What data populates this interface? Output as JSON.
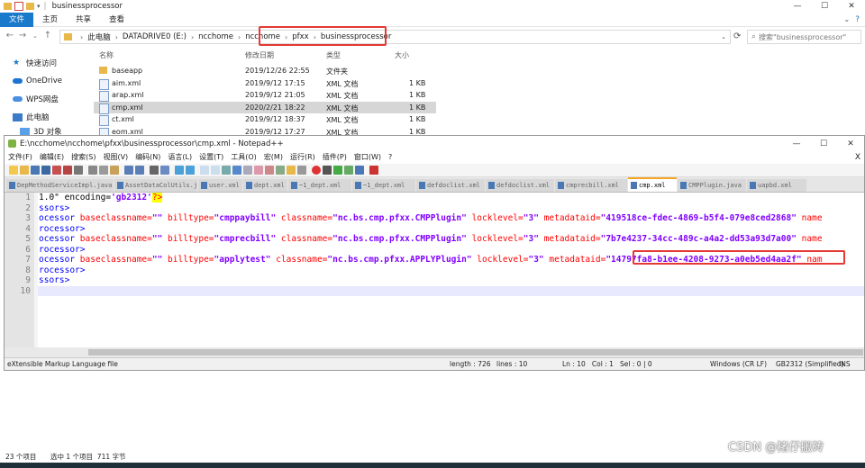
{
  "explorer": {
    "title": "businessprocessor",
    "ribbon_tabs": [
      "文件",
      "主页",
      "共享",
      "查看"
    ],
    "breadcrumb": [
      "此电脑",
      "DATADRIVE0 (E:)",
      "ncchome",
      "ncchome",
      "pfxx",
      "businessprocessor"
    ],
    "search_placeholder": "搜索\"businessprocessor\"",
    "columns": {
      "name": "名称",
      "date": "修改日期",
      "type": "类型",
      "size": "大小"
    },
    "nav_items": [
      "快速访问",
      "OneDrive",
      "WPS网盘",
      "此电脑",
      "3D 对象"
    ],
    "files": [
      {
        "name": "baseapp",
        "date": "2019/12/26 22:55",
        "type": "文件夹",
        "size": "",
        "kind": "folder"
      },
      {
        "name": "aim.xml",
        "date": "2019/9/12 17:15",
        "type": "XML 文档",
        "size": "1 KB",
        "kind": "xml"
      },
      {
        "name": "arap.xml",
        "date": "2019/9/12 21:05",
        "type": "XML 文档",
        "size": "1 KB",
        "kind": "xml"
      },
      {
        "name": "cmp.xml",
        "date": "2020/2/21 18:22",
        "type": "XML 文档",
        "size": "1 KB",
        "kind": "xml",
        "selected": true
      },
      {
        "name": "ct.xml",
        "date": "2019/9/12 18:37",
        "type": "XML 文档",
        "size": "1 KB",
        "kind": "xml"
      },
      {
        "name": "eom.xml",
        "date": "2019/9/12 17:27",
        "type": "XML 文档",
        "size": "1 KB",
        "kind": "xml"
      }
    ],
    "status_count": "23 个项目",
    "status_selected": "选中 1 个项目  711 字节"
  },
  "notepad": {
    "title": "E:\\ncchome\\ncchome\\pfxx\\businessprocessor\\cmp.xml - Notepad++",
    "menu": [
      "文件(F)",
      "编辑(E)",
      "搜索(S)",
      "视图(V)",
      "编码(N)",
      "语言(L)",
      "设置(T)",
      "工具(O)",
      "宏(M)",
      "运行(R)",
      "插件(P)",
      "窗口(W)",
      "?"
    ],
    "tabs": [
      "DepMethodServiceImpl.java",
      "AssetDataColUtils.java",
      "user.xml",
      "dept.xml",
      "~1_dept.xml",
      "~1_dept.xml",
      "defdoclist.xml",
      "defdoclist.xml",
      "cmprecbill.xml",
      "cmp.xml",
      "CMPPlugin.java",
      "uapbd.xml"
    ],
    "active_tab": 9,
    "lines": {
      "l1a": "1.0\" encoding=",
      "l1b": "'gb2312'",
      "l1c": "?>",
      "l2": "ssors>",
      "l3": {
        "tag": "ocessor",
        "a1": "baseclassname=",
        "v1": "\"\"",
        "a2": "billtype=",
        "v2": "\"cmppaybill\"",
        "a3": "classname=",
        "v3": "\"nc.bs.cmp.pfxx.CMPPlugin\"",
        "a4": "locklevel=",
        "v4": "\"3\"",
        "a5": "metadataid=",
        "v5": "\"419518ce-fdec-4869-b5f4-079e8ced2868\"",
        "a6": "name"
      },
      "l4": "rocessor>",
      "l5": {
        "tag": "ocessor",
        "a1": "baseclassname=",
        "v1": "\"\"",
        "a2": "billtype=",
        "v2": "\"cmprecbill\"",
        "a3": "classname=",
        "v3": "\"nc.bs.cmp.pfxx.CMPPlugin\"",
        "a4": "locklevel=",
        "v4": "\"3\"",
        "a5": "metadataid=",
        "v5": "\"7b7e4237-34cc-489c-a4a2-dd53a93d7a00\"",
        "a6": "name"
      },
      "l6": "rocessor>",
      "l7": {
        "tag": "ocessor",
        "a1": "baseclassname=",
        "v1": "\"\"",
        "a2": "billtype=",
        "v2": "\"applytest\"",
        "a3": "classname=",
        "v3": "\"nc.bs.cmp.pfxx.APPLYPlugin\"",
        "a4": "locklevel=",
        "v4": "\"3\"",
        "a5": "metadataid=",
        "v5": "\"14797fa8-b1ee-4208-9273-a0eb5ed4aa2f\"",
        "a6": "nam"
      },
      "l8": "rocessor>",
      "l9": "ssors>",
      "l10": ""
    },
    "line_numbers": [
      "1",
      "2",
      "3",
      "4",
      "5",
      "6",
      "7",
      "8",
      "9",
      "10"
    ],
    "status": {
      "filetype": "eXtensible Markup Language file",
      "length": "length : 726",
      "lines": "lines : 10",
      "pos": "Ln : 10   Col : 1   Sel : 0 | 0",
      "eol": "Windows (CR LF)",
      "encoding": "GB2312 (Simplified)",
      "mode": "INS"
    }
  },
  "watermark": "CSDN @猪仔搬砖",
  "colors": {
    "accent": "#1979ca",
    "highlight": "#e53935",
    "folder": "#e8b84a"
  }
}
